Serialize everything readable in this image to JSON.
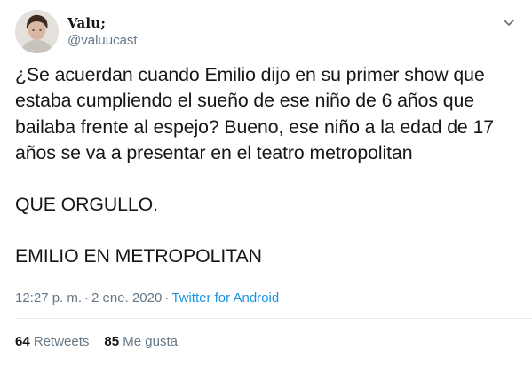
{
  "user": {
    "display_name": "Valu;",
    "handle": "@valuucast"
  },
  "tweet": {
    "paragraphs": [
      "¿Se acuerdan cuando Emilio dijo en su primer show que estaba cumpliendo el sueño de ese niño de 6 años que bailaba frente al espejo? Bueno, ese niño a la edad de 17 años se va a presentar en el teatro metropolitan",
      "QUE ORGULLO.",
      "EMILIO EN METROPOLITAN"
    ],
    "time": "12:27 p. m.",
    "date": "2 ene. 2020",
    "separator": "·",
    "source": "Twitter for Android"
  },
  "stats": {
    "retweets_count": "64",
    "retweets_label": "Retweets",
    "likes_count": "85",
    "likes_label": "Me gusta"
  },
  "icons": {
    "menu": "chevron-down-icon"
  },
  "colors": {
    "text": "#14171a",
    "secondary": "#657786",
    "link": "#1b95e0",
    "divider": "#e6ecf0"
  }
}
